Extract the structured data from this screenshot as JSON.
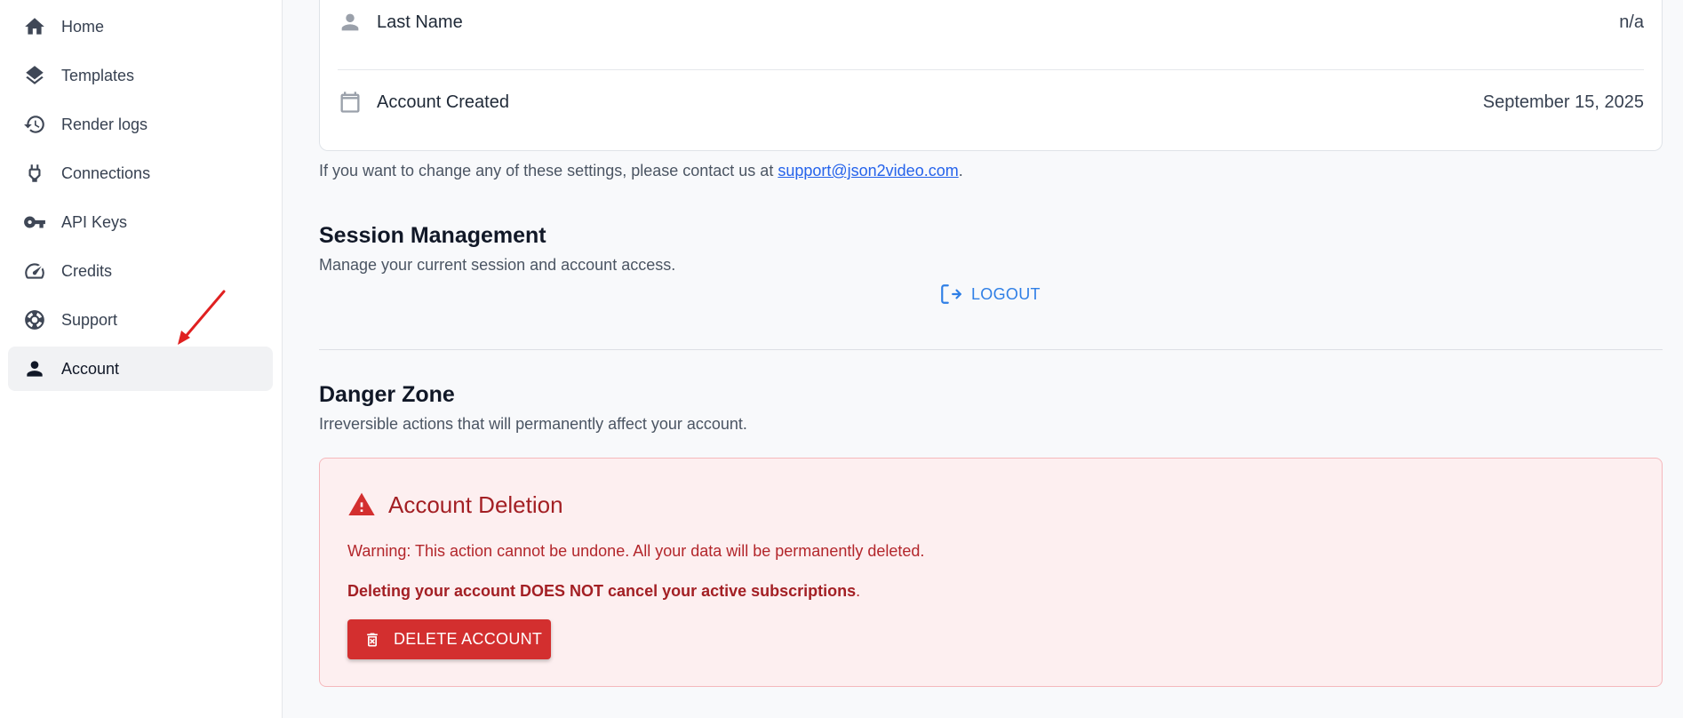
{
  "sidebar": {
    "items": [
      {
        "label": "Home",
        "icon": "home-icon"
      },
      {
        "label": "Templates",
        "icon": "layers-icon"
      },
      {
        "label": "Render logs",
        "icon": "history-icon"
      },
      {
        "label": "Connections",
        "icon": "power-plug-icon"
      },
      {
        "label": "API Keys",
        "icon": "key-icon"
      },
      {
        "label": "Credits",
        "icon": "speedometer-icon"
      },
      {
        "label": "Support",
        "icon": "lifebuoy-icon"
      },
      {
        "label": "Account",
        "icon": "person-icon",
        "active": true
      }
    ]
  },
  "account": {
    "rows": [
      {
        "label": "Last Name",
        "value": "n/a",
        "icon": "person-icon"
      },
      {
        "label": "Account Created",
        "value": "September 15, 2025",
        "icon": "calendar-icon"
      }
    ],
    "note_prefix": "If you want to change any of these settings, please contact us at ",
    "note_email": "support@json2video.com",
    "note_suffix": "."
  },
  "session": {
    "title": "Session Management",
    "description": "Manage your current session and account access.",
    "logout_label": "LOGOUT"
  },
  "danger": {
    "title": "Danger Zone",
    "description": "Irreversible actions that will permanently affect your account.",
    "box_title": "Account Deletion",
    "warning": "Warning: This action cannot be undone. All your data will be permanently deleted.",
    "note_bold": "Deleting your account DOES NOT cancel your active subscriptions",
    "note_suffix": ".",
    "delete_label": "DELETE ACCOUNT"
  },
  "colors": {
    "accent": "#2f7fe6",
    "danger": "#d32f2f",
    "danger_bg": "#fdeff0"
  }
}
